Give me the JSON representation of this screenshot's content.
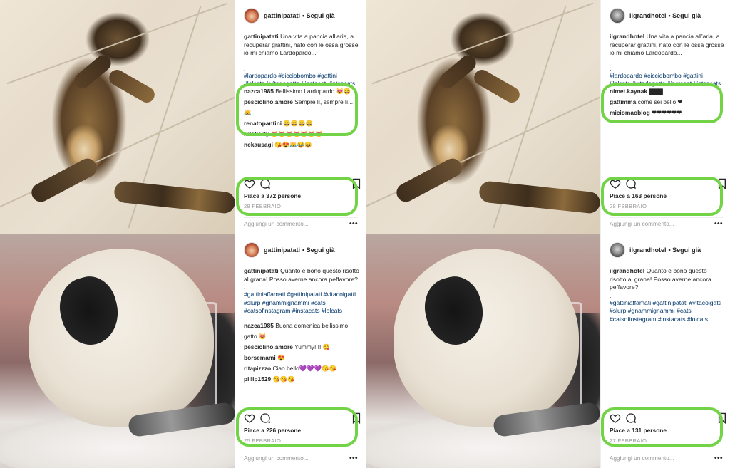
{
  "posts": [
    {
      "username": "gattinipatati",
      "follow_label": "• Segui già",
      "caption_text": "Una vita a pancia all'aria, a recuperar grattini, nato con le ossa grosse io mi chiamo Lardopardo...",
      "dots": [
        ".",
        "."
      ],
      "hashtags": "#lardopardo #cicciobombo #gattini #lolcats #vitadagatto #instacat #intsacats",
      "comments": [
        {
          "user": "nazca1985",
          "text": "Bellissimo Lardopardo 😻😄"
        },
        {
          "user": "pesciolino.amore",
          "text": "Sempre lì, sempre lì... 😹"
        },
        {
          "user": "renatopantini",
          "text": "😄😄😄😄"
        },
        {
          "user": "nitokerty",
          "text": "😻😻😻😻😻😻😻"
        },
        {
          "user": "nekausagi",
          "text": "😘😍😹😂😄"
        }
      ],
      "likes": "Piace a 372 persone",
      "date": "28 FEBBRAIO",
      "add_comment_placeholder": "Aggiungi un commento...",
      "more": "•••"
    },
    {
      "username": "ilgrandhotel",
      "follow_label": "• Segui già",
      "caption_text": "Una vita a pancia all'aria, a recuperar grattini, nato con le ossa grosse io mi chiamo Lardopardo...",
      "dots": [
        ".",
        "."
      ],
      "hashtags": "#lardopardo #cicciobombo #gattini #lolcats #vitadagatto #instacat #intsacats",
      "comments": [
        {
          "user": "nimet.kaynak",
          "text": "▇▇▇"
        },
        {
          "user": "gattimma",
          "text": "come sei bello ❤"
        },
        {
          "user": "miciomaoblog",
          "text": "❤❤❤❤❤❤"
        }
      ],
      "likes": "Piace a 163 persone",
      "date": "28 FEBBRAIO",
      "add_comment_placeholder": "Aggiungi un commento...",
      "more": "•••"
    },
    {
      "username": "gattinipatati",
      "follow_label": "• Segui già",
      "caption_text": "Quanto è bono questo risotto al grana! Posso averne ancora peffavore?",
      "dots": [
        "."
      ],
      "hashtags": "#gattiniaffamati #gattinipatati #vitacoigatti #slurp #gnammignammi #cats #catsofinstagram #instacats #lolcats",
      "comments": [
        {
          "user": "nazca1985",
          "text": "Buona domenica bellissimo gatto 😻"
        },
        {
          "user": "pesciolino.amore",
          "text": "Yummy!!!! 😋"
        },
        {
          "user": "borsemami",
          "text": "😍"
        },
        {
          "user": "ritapizzzo",
          "text": "Ciao bello💜💜💜😘😘"
        },
        {
          "user": "pillip1529",
          "text": "😘😘😘"
        }
      ],
      "likes": "Piace a 226 persone",
      "date": "25 FEBBRAIO",
      "add_comment_placeholder": "Aggiungi un commento...",
      "more": "•••"
    },
    {
      "username": "ilgrandhotel",
      "follow_label": "• Segui già",
      "caption_text": "Quanto è bono questo risotto al grana! Posso averne ancora peffavore?",
      "dots": [
        "."
      ],
      "hashtags": "#gattiniaffamati #gattinipatati #vitacoigatti #slurp #gnammignammi #cats #catsofinstagram #instacats #lolcats",
      "comments": [],
      "likes": "Piace a 131 persone",
      "date": "27 FEBBRAIO",
      "add_comment_placeholder": "Aggiungi un commento...",
      "more": "•••"
    }
  ],
  "icons": {
    "like": "heart-icon",
    "comment": "comment-icon",
    "save": "bookmark-icon",
    "more": "more-icon"
  },
  "colors": {
    "highlight": "#73d346",
    "hashtag": "#003569",
    "text": "#262626",
    "muted": "#999999"
  }
}
